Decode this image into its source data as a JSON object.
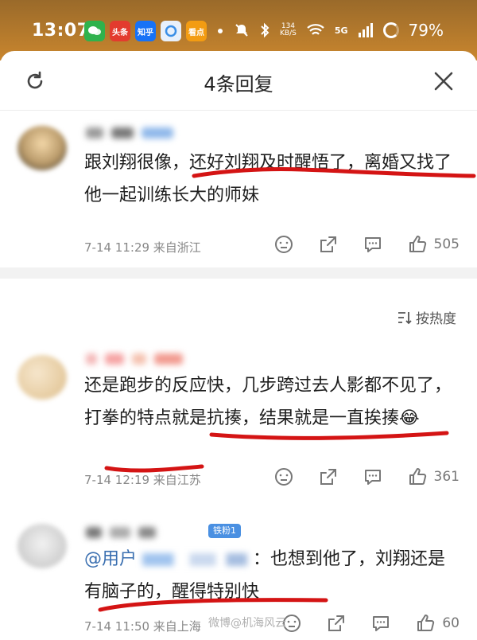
{
  "status_bar": {
    "time": "13:07",
    "apps": [
      {
        "name": "wechat-app-icon",
        "label": "",
        "color": "#2fb24c"
      },
      {
        "name": "toutiao-app-icon",
        "label": "头条",
        "color": "#e33b2e"
      },
      {
        "name": "zhihu-app-icon",
        "label": "知乎",
        "color": "#1772f6"
      },
      {
        "name": "browser-app-icon",
        "label": "",
        "color": "#3a8ee6"
      },
      {
        "name": "news-app-icon",
        "label": "看点",
        "color": "#f39c12"
      }
    ],
    "network_speed_value": "134",
    "network_speed_unit": "KB/S",
    "signal": "5G",
    "battery": "79%"
  },
  "sheet": {
    "title": "4条回复",
    "refresh_icon": "refresh-icon",
    "close_icon": "close-icon"
  },
  "sort_label": "按热度",
  "comments": [
    {
      "text": "跟刘翔很像，还好刘翔及时醒悟了，离婚又找了他一起训练长大的师妹",
      "date": "7-14 11:29 来自浙江",
      "likes": "505"
    },
    {
      "text": "还是跑步的反应快，几步跨过去人影都不见了，打拳的特点就是抗揍，结果就是一直挨揍😂",
      "date": "7-14 12:19 来自江苏",
      "likes": "361"
    },
    {
      "badge": "铁粉1",
      "mention": "@用户",
      "text": "：也想到他了，刘翔还是有脑子的，醒得特别快",
      "date": "7-14 11:50 来自上海",
      "likes": "60"
    }
  ],
  "watermark": "微博@机海风云",
  "colors": {
    "status_bar": "#b97a2c",
    "underline": "#d41414",
    "mention": "#3a6fb0",
    "badge": "#4a90e2"
  }
}
